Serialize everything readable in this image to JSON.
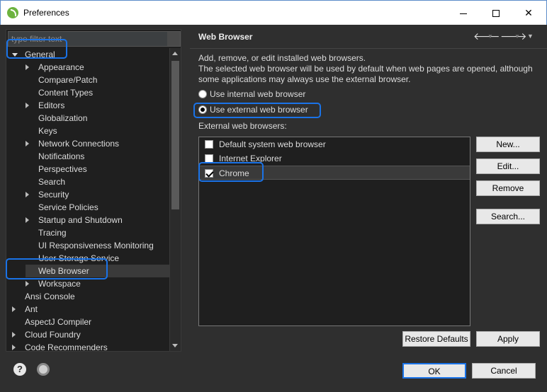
{
  "window": {
    "title": "Preferences"
  },
  "sidebar": {
    "filter_placeholder": "type filter text",
    "items": [
      {
        "label": "General",
        "arrow": "open",
        "indent": 0
      },
      {
        "label": "Appearance",
        "arrow": "closed",
        "indent": 1
      },
      {
        "label": "Compare/Patch",
        "arrow": "none",
        "indent": 1
      },
      {
        "label": "Content Types",
        "arrow": "none",
        "indent": 1
      },
      {
        "label": "Editors",
        "arrow": "closed",
        "indent": 1
      },
      {
        "label": "Globalization",
        "arrow": "none",
        "indent": 1
      },
      {
        "label": "Keys",
        "arrow": "none",
        "indent": 1
      },
      {
        "label": "Network Connections",
        "arrow": "closed",
        "indent": 1
      },
      {
        "label": "Notifications",
        "arrow": "none",
        "indent": 1
      },
      {
        "label": "Perspectives",
        "arrow": "none",
        "indent": 1
      },
      {
        "label": "Search",
        "arrow": "none",
        "indent": 1
      },
      {
        "label": "Security",
        "arrow": "closed",
        "indent": 1
      },
      {
        "label": "Service Policies",
        "arrow": "none",
        "indent": 1
      },
      {
        "label": "Startup and Shutdown",
        "arrow": "closed",
        "indent": 1
      },
      {
        "label": "Tracing",
        "arrow": "none",
        "indent": 1
      },
      {
        "label": "UI Responsiveness Monitoring",
        "arrow": "none",
        "indent": 1
      },
      {
        "label": "User Storage Service",
        "arrow": "none",
        "indent": 1
      },
      {
        "label": "Web Browser",
        "arrow": "none",
        "indent": 1,
        "selected": true
      },
      {
        "label": "Workspace",
        "arrow": "closed",
        "indent": 1
      },
      {
        "label": "Ansi Console",
        "arrow": "none",
        "indent": 0
      },
      {
        "label": "Ant",
        "arrow": "closed",
        "indent": 0
      },
      {
        "label": "AspectJ Compiler",
        "arrow": "none",
        "indent": 0
      },
      {
        "label": "Cloud Foundry",
        "arrow": "closed",
        "indent": 0
      },
      {
        "label": "Code Recommenders",
        "arrow": "closed",
        "indent": 0
      }
    ]
  },
  "page": {
    "title": "Web Browser",
    "description_line1": "Add, remove, or edit installed web browsers.",
    "description_line2": "The selected web browser will be used by default when web pages are opened, although",
    "description_line3": "some applications may always use the external browser.",
    "radio_internal": "Use internal web browser",
    "radio_external": "Use external web browser",
    "selected_mode": "external",
    "external_label": "External web browsers:",
    "browsers": [
      {
        "name": "Default system web browser",
        "checked": false
      },
      {
        "name": "Internet Explorer",
        "checked": false
      },
      {
        "name": "Chrome",
        "checked": true,
        "selected": true
      }
    ],
    "buttons": {
      "new": "New...",
      "edit": "Edit...",
      "remove": "Remove",
      "search": "Search...",
      "restore_defaults": "Restore Defaults",
      "apply": "Apply"
    }
  },
  "footer": {
    "help_glyph": "?",
    "ok": "OK",
    "cancel": "Cancel"
  },
  "colors": {
    "highlight": "#1a73e8",
    "background": "#2f2f2f",
    "tree_background": "#1f1f1f"
  }
}
